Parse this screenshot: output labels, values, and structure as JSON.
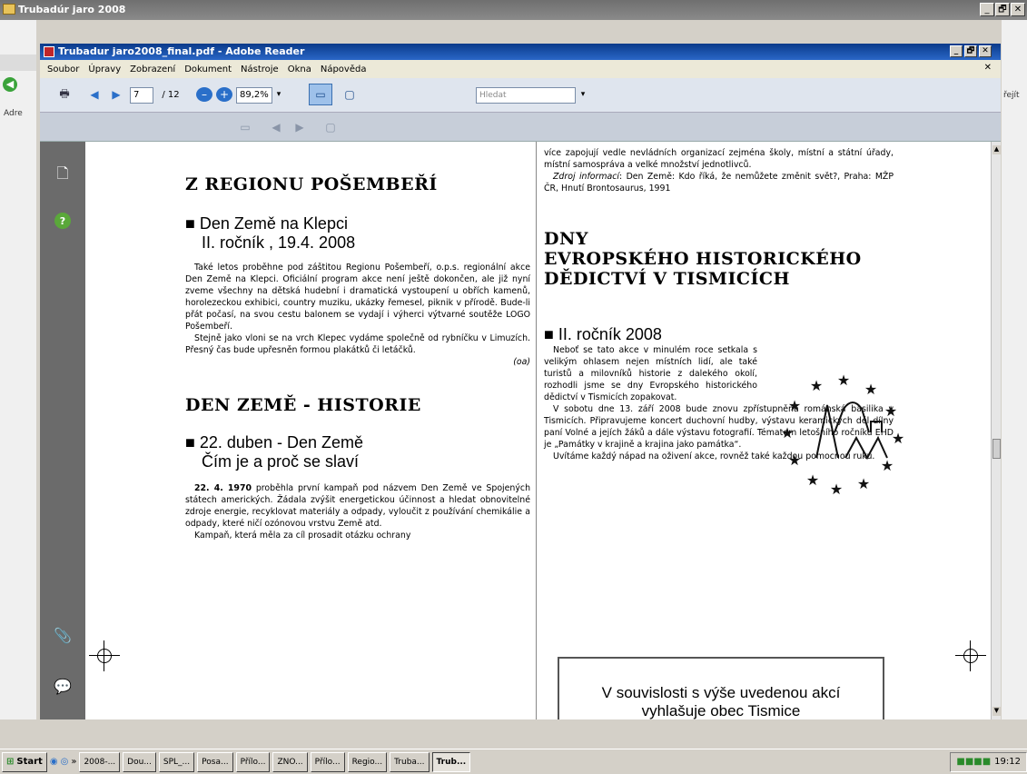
{
  "outer_window": {
    "title": "Trubadúr jaro 2008",
    "min": "_",
    "max": "🗗",
    "close": "✕"
  },
  "outer_left_label": "Adre",
  "outer_right_label": "řejít",
  "adobe": {
    "title": "Trubadur jaro2008_final.pdf - Adobe Reader",
    "menu": [
      "Soubor",
      "Úpravy",
      "Zobrazení",
      "Dokument",
      "Nástroje",
      "Okna",
      "Nápověda"
    ],
    "menu_close": "✕",
    "page_current": "7",
    "page_total": "/ 12",
    "zoom": "89,2%",
    "zoom_arrow": "▾",
    "search_placeholder": "Hledat",
    "search_arrow": "▾",
    "icons": {
      "print": "🖶",
      "prev": "◀",
      "next": "▶",
      "zoom_out": "–",
      "zoom_in": "+",
      "fit_page": "▭",
      "fit_width": "▢",
      "doc": "🗋",
      "help": "?",
      "attach": "📎",
      "comment": "💬"
    }
  },
  "page": {
    "left": {
      "h1": "Z REGIONU POŠEMBEŘÍ",
      "h2a": "Den Země na Klepci",
      "h2b": "II. ročník , 19.4. 2008",
      "p1": "Také letos proběhne pod záštitou Regionu Pošembeří, o.p.s. regionální akce Den Země na Klepci. Oficiální program akce není ještě dokončen, ale již nyní zveme všechny na dětská hudební i dramatická vystoupení u obřích kamenů, horolezeckou exhibici, country muziku, ukázky řemesel, piknik v přírodě. Bude-li přát počasí, na svou cestu balonem se vydají i výherci výtvarné soutěže LOGO Pošembeří.",
      "p2": "Stejně jako vloni se na vrch Klepec vydáme společně od rybníčku v Limuzích. Přesný čas bude upřesněn formou plakátků či letáčků.",
      "sig": "(oa)",
      "h1b": "DEN ZEMĚ - HISTORIE",
      "h2c": "22. duben - Den Země",
      "h2d": "Čím je a proč se slaví",
      "p3_bold": "22. 4. 1970",
      "p3": " proběhla první kampaň pod názvem Den Země ve Spojených státech amerických. Žádala zvýšit energetickou účinnost a hledat obnovitelné zdroje energie, recyklovat materiály a odpady, vyloučit z používání chemikálie a odpady, které ničí ozónovou vrstvu Země atd.",
      "p4": "Kampaň, která měla za cíl prosadit otázku ochrany"
    },
    "right": {
      "p1": "více zapojují vedle nevládních organizací zejména školy, místní a státní úřady, místní samospráva a velké množství jednotlivců.",
      "p2_italic": "Zdroj informací",
      "p2": ": Den Země: Kdo říká, že nemůžete změnit svět?, Praha: MŽP ČR, Hnutí Brontosaurus, 1991",
      "h1a": "DNY",
      "h1b": "EVROPSKÉHO HISTORICKÉHO",
      "h1c": "DĚDICTVÍ V TISMICÍCH",
      "h2": "II. ročník 2008",
      "p3": "Neboť se tato akce v minulém roce setkala s velikým ohlasem nejen místních lidí, ale také turistů a milovníků historie z dalekého okolí, rozhodli jsme se dny Evropského historického dědictví v Tismicích zopakovat.",
      "p4": "V sobotu dne 13. září 2008 bude znovu zpřístupněna románská basilika v Tismicích. Připravujeme koncert duchovní hudby, výstavu keramických děl dílny paní Volné a jejích žáků a dále výstavu fotografií. Tématem letošního ročníku EHD je „Památky v krajině a krajina jako památka“.",
      "p5": "Uvítáme každý nápad na oživení akce, rovněž také každou pomocnou ruku.",
      "box_line1": "V souvislosti s výše uvedenou akcí",
      "box_line2": "vyhlašuje obec Tismice"
    }
  },
  "taskbar": {
    "start": "Start",
    "buttons": [
      "2008-...",
      "Dou...",
      "SPL_...",
      "Posa...",
      "Přílo...",
      "ZNO...",
      "Přílo...",
      "Regio...",
      "Truba...",
      "Trub..."
    ],
    "clock": "19:12"
  }
}
